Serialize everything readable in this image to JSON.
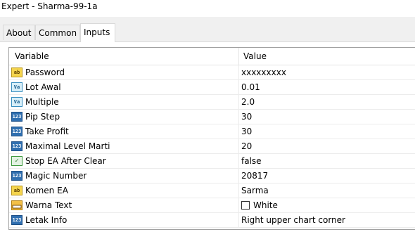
{
  "window": {
    "title": "Expert - Sharma-99-1a"
  },
  "tabs": [
    {
      "label": "About"
    },
    {
      "label": "Common"
    },
    {
      "label": "Inputs"
    }
  ],
  "table": {
    "headers": {
      "variable": "Variable",
      "value": "Value"
    },
    "rows": [
      {
        "icon": "ab-string-icon",
        "name": "Password",
        "value": "xxxxxxxxx"
      },
      {
        "icon": "va-double-icon",
        "name": "Lot Awal",
        "value": "0.01"
      },
      {
        "icon": "va-double-icon",
        "name": "Multiple",
        "value": "2.0"
      },
      {
        "icon": "123-integer-icon",
        "name": "Pip Step",
        "value": "30"
      },
      {
        "icon": "123-integer-icon",
        "name": "Take Profit",
        "value": "30"
      },
      {
        "icon": "123-integer-icon",
        "name": "Maximal Level Marti",
        "value": "20"
      },
      {
        "icon": "bool-icon",
        "name": "Stop EA After Clear",
        "value": "false"
      },
      {
        "icon": "123-integer-icon",
        "name": "Magic Number",
        "value": "20817"
      },
      {
        "icon": "ab-string-icon",
        "name": "Komen EA",
        "value": "Sarma"
      },
      {
        "icon": "color-icon",
        "name": "Warna Text",
        "value": "White"
      },
      {
        "icon": "123-integer-icon",
        "name": "Letak Info",
        "value": "Right upper chart corner"
      }
    ]
  },
  "icon_glyphs": {
    "ab": "ab",
    "va": "Va",
    "num": "123",
    "bool": "✓"
  }
}
